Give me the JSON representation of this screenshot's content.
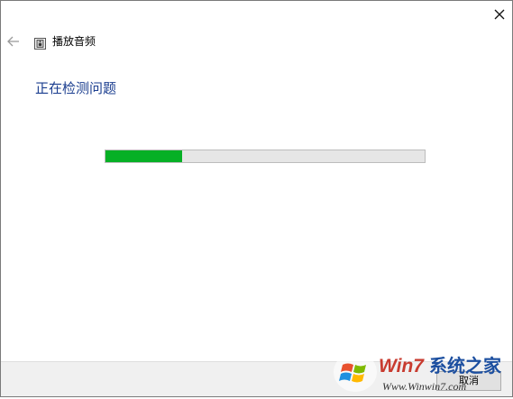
{
  "window": {
    "title": "播放音频",
    "close_icon": "close-icon",
    "back_icon": "back-arrow-icon",
    "app_icon": "audio-troubleshooter-icon"
  },
  "main": {
    "heading": "正在检测问题"
  },
  "progress": {
    "fraction": 0.24,
    "color": "#06b025"
  },
  "footer": {
    "cancel_label": "取消"
  },
  "watermark": {
    "brand_text": "Win7系统之家",
    "url_text": "Www.Winwin7.com"
  }
}
